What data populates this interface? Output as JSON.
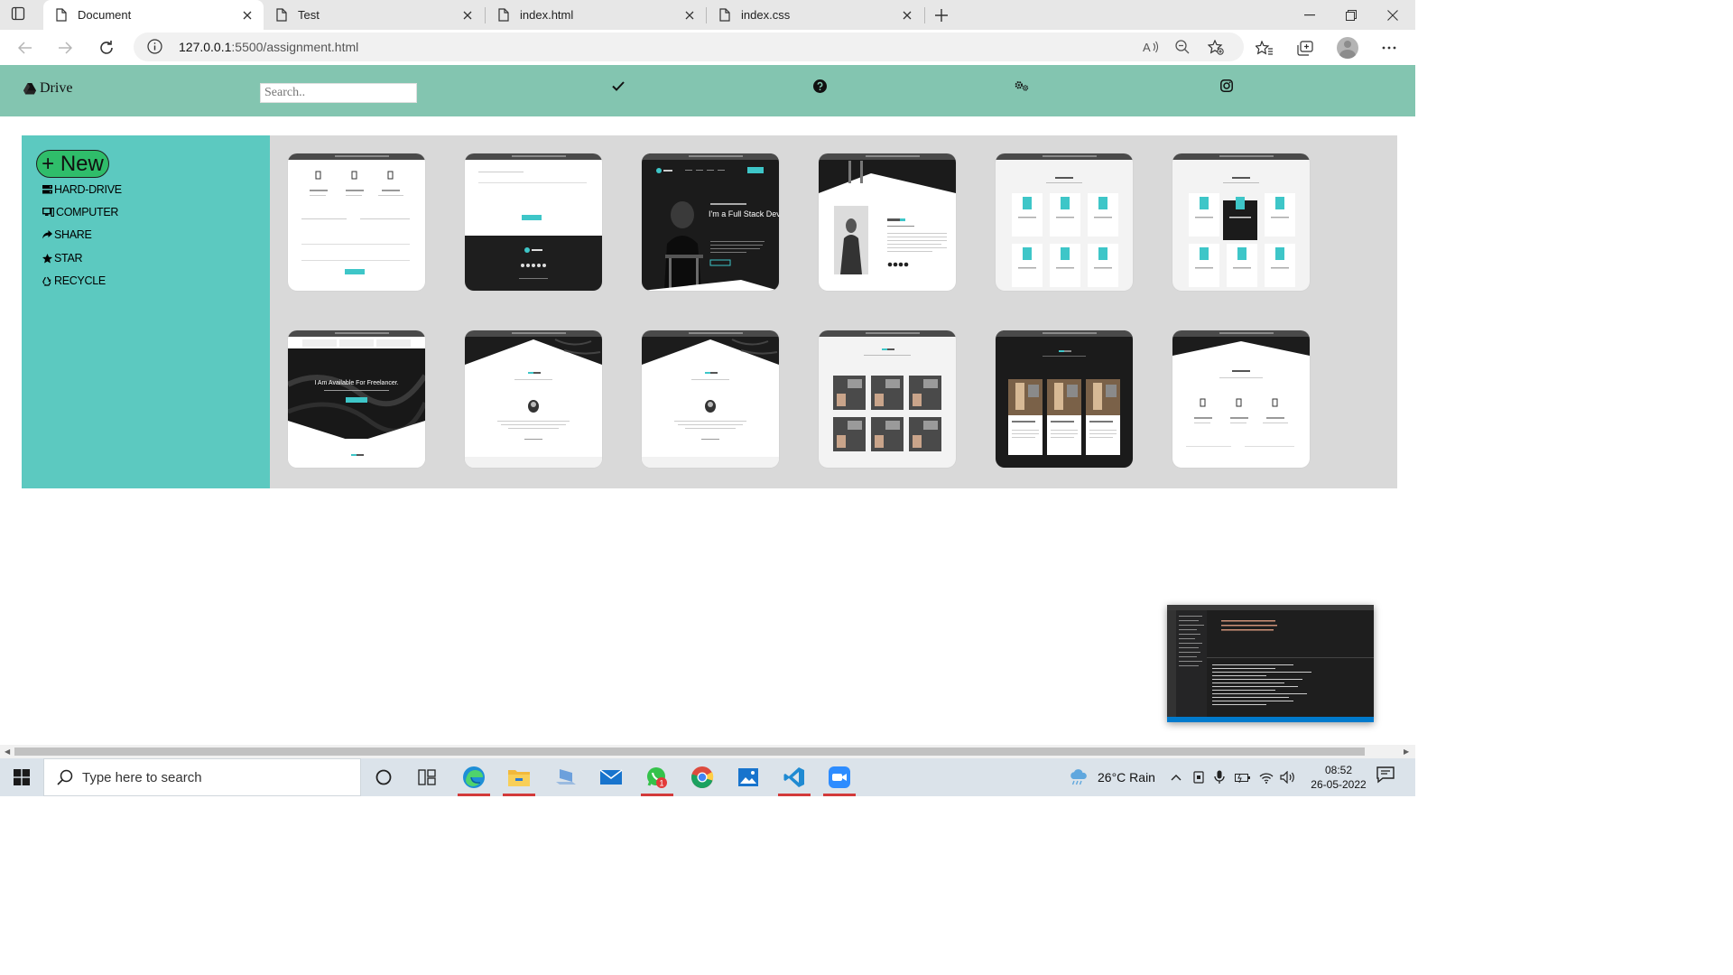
{
  "browser": {
    "tabs": [
      {
        "title": "Document",
        "active": true
      },
      {
        "title": "Test",
        "active": false
      },
      {
        "title": "index.html",
        "active": false
      },
      {
        "title": "index.css",
        "active": false
      }
    ],
    "url_host": "127.0.0.1",
    "url_rest": ":5500/assignment.html"
  },
  "page": {
    "brand": "Drive",
    "search_placeholder": "Search..",
    "nav_icons": [
      "check-icon",
      "question-circle-icon",
      "gears-icon",
      "instagram-icon"
    ],
    "new_button": "+ New",
    "sidebar": [
      {
        "label": "HARD-DRIVE",
        "icon": "hard-drive-icon"
      },
      {
        "label": "COMPUTER",
        "icon": "computer-icon"
      },
      {
        "label": "SHARE",
        "icon": "share-icon"
      },
      {
        "label": "STAR",
        "icon": "star-icon"
      },
      {
        "label": "RECYCLE",
        "icon": "recycle-icon"
      }
    ],
    "thumbnails": [
      {
        "text": ""
      },
      {
        "text": ""
      },
      {
        "text": "I'm a Full Stack Developer"
      },
      {
        "text": ""
      },
      {
        "text": ""
      },
      {
        "text": ""
      },
      {
        "text": "I Am Available For Freelancer."
      },
      {
        "text": ""
      },
      {
        "text": ""
      },
      {
        "text": ""
      },
      {
        "text": ""
      },
      {
        "text": ""
      }
    ]
  },
  "taskbar": {
    "search_placeholder": "Type here to search",
    "weather": "26°C  Rain",
    "time": "08:52",
    "date": "26-05-2022",
    "whatsapp_badge": "1"
  },
  "colors": {
    "navbar": "#83c5b0",
    "sidebar": "#5cc9c0",
    "new_button": "#2fbd6a",
    "gallery_bg": "#d9d9d9",
    "accent_cyan": "#3ec6c8"
  }
}
